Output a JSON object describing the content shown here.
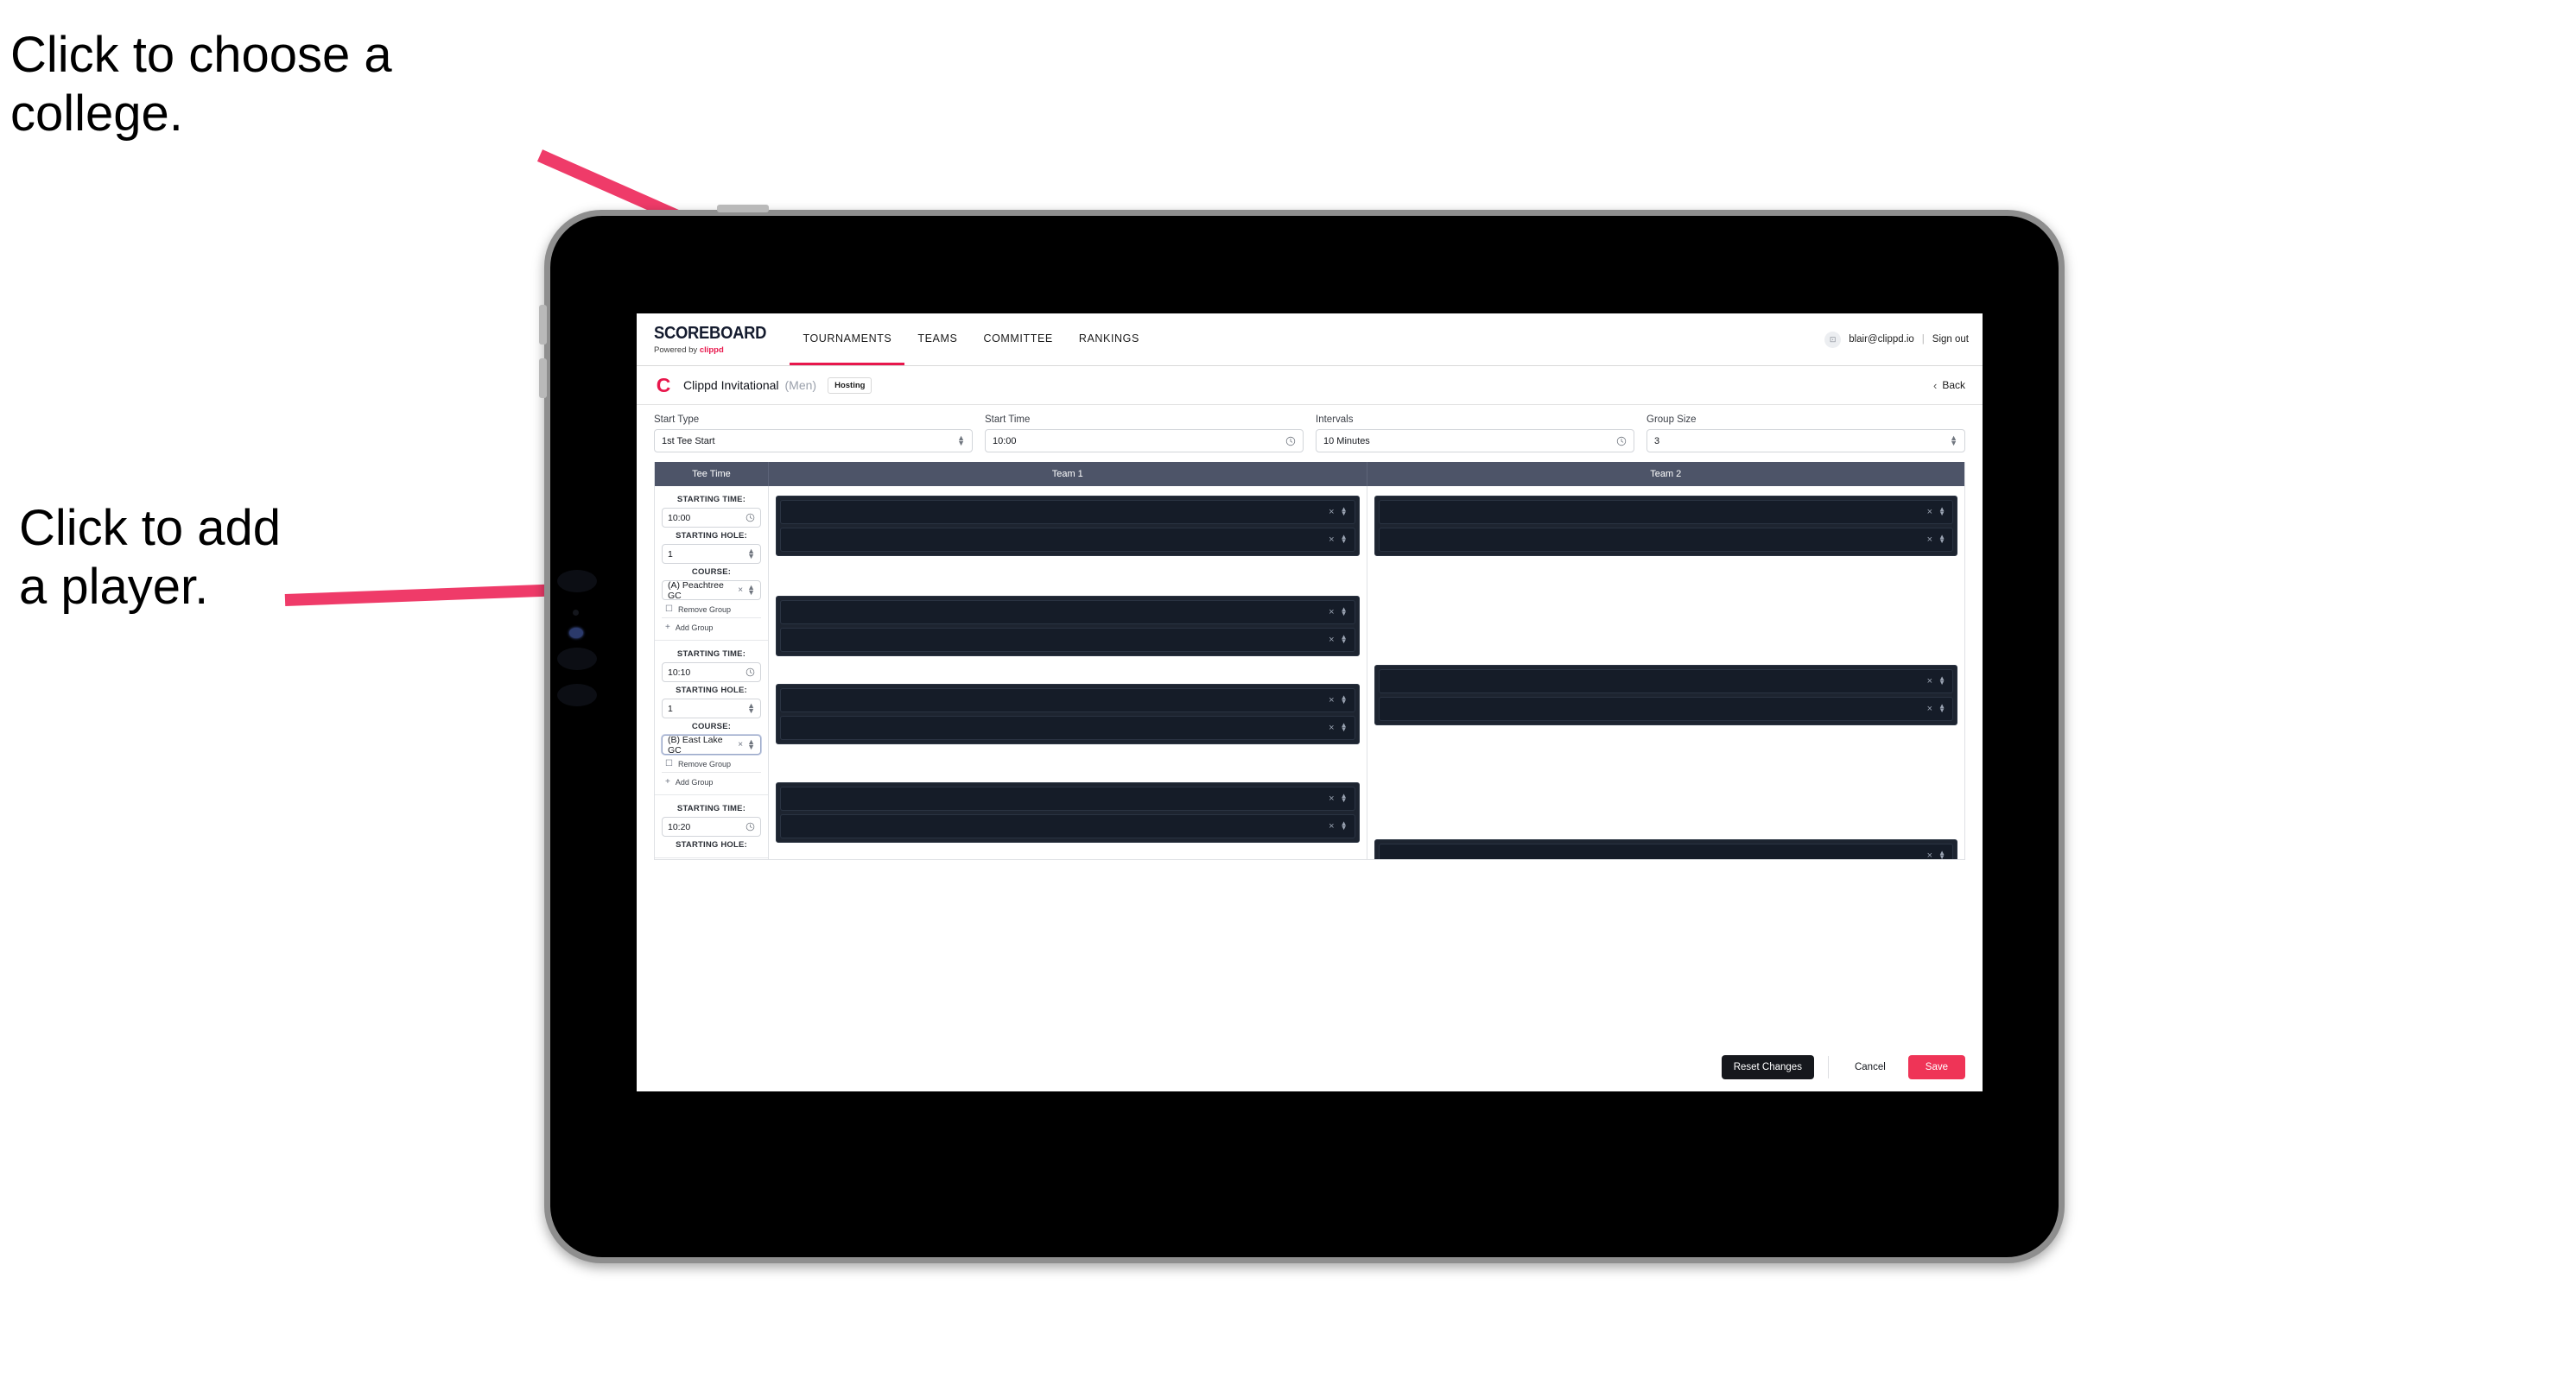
{
  "annotations": [
    {
      "id": "college",
      "text": "Click to choose a\ncollege."
    },
    {
      "id": "player",
      "text": "Click to add\na player."
    }
  ],
  "colors": {
    "accent": "#e8174c",
    "save": "#ef3457",
    "header_row": "#4d5468",
    "card_bg": "#1d2430",
    "slot_bg": "#151c28",
    "arrow": "#ef3b69"
  },
  "nav": {
    "brand": {
      "title": "SCOREBOARD",
      "powered_prefix": "Powered by ",
      "powered_brand": "clippd"
    },
    "tabs": [
      {
        "label": "TOURNAMENTS",
        "active": true
      },
      {
        "label": "TEAMS",
        "active": false
      },
      {
        "label": "COMMITTEE",
        "active": false
      },
      {
        "label": "RANKINGS",
        "active": false
      }
    ],
    "account": {
      "avatar_glyph": "⊡",
      "email": "blair@clippd.io",
      "separator": "|",
      "signout": "Sign out"
    }
  },
  "tournament": {
    "logo_letter": "C",
    "name": "Clippd Invitational",
    "gender": "(Men)",
    "badge": "Hosting",
    "back_chevron": "‹",
    "back_label": "Back"
  },
  "settings": [
    {
      "label": "Start Type",
      "value": "1st Tee Start",
      "adorn": "stepper"
    },
    {
      "label": "Start Time",
      "value": "10:00",
      "adorn": "clock"
    },
    {
      "label": "Intervals",
      "value": "10 Minutes",
      "adorn": "clock"
    },
    {
      "label": "Group Size",
      "value": "3",
      "adorn": "stepper"
    }
  ],
  "table": {
    "headers": [
      "Tee Time",
      "Team 1",
      "Team 2"
    ],
    "labels": {
      "starting_time": "STARTING TIME:",
      "starting_hole": "STARTING HOLE:",
      "course": "COURSE:",
      "remove_group": "Remove Group",
      "add_group": "Add Group",
      "remove_icon": "☐",
      "add_icon": "+",
      "clear_icon": "×",
      "clock_icon": "◴"
    },
    "rows": [
      {
        "starting_time": "10:00",
        "starting_hole": "1",
        "course": "(A) Peachtree GC",
        "course_focused": false,
        "team1_cards": [
          2,
          2
        ],
        "team2_cards": [
          2
        ]
      },
      {
        "starting_time": "10:10",
        "starting_hole": "1",
        "course": "(B) East Lake GC",
        "course_focused": true,
        "team1_cards": [
          2,
          2
        ],
        "team2_cards": [
          2
        ]
      },
      {
        "starting_time": "10:20",
        "starting_hole": "",
        "course": "",
        "course_focused": false,
        "team1_cards": [
          2
        ],
        "team2_cards": [
          2
        ]
      }
    ]
  },
  "footer": {
    "reset": "Reset Changes",
    "cancel": "Cancel",
    "save": "Save"
  }
}
